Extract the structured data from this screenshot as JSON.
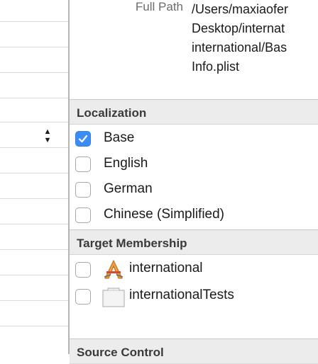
{
  "full_path": {
    "label": "Full Path",
    "lines": [
      "/Users/maxiaofer",
      "Desktop/internat",
      "international/Bas",
      "Info.plist"
    ]
  },
  "localization": {
    "title": "Localization",
    "items": [
      {
        "label": "Base",
        "checked": true
      },
      {
        "label": "English",
        "checked": false
      },
      {
        "label": "German",
        "checked": false
      },
      {
        "label": "Chinese (Simplified)",
        "checked": false
      }
    ]
  },
  "target_membership": {
    "title": "Target Membership",
    "items": [
      {
        "label": "international",
        "checked": false,
        "icon": "app-target-icon"
      },
      {
        "label": "internationalTests",
        "checked": false,
        "icon": "test-bundle-icon"
      }
    ]
  },
  "source_control": {
    "title": "Source Control"
  },
  "colors": {
    "accent": "#3b8cf5",
    "section_bg": "#ececec"
  }
}
